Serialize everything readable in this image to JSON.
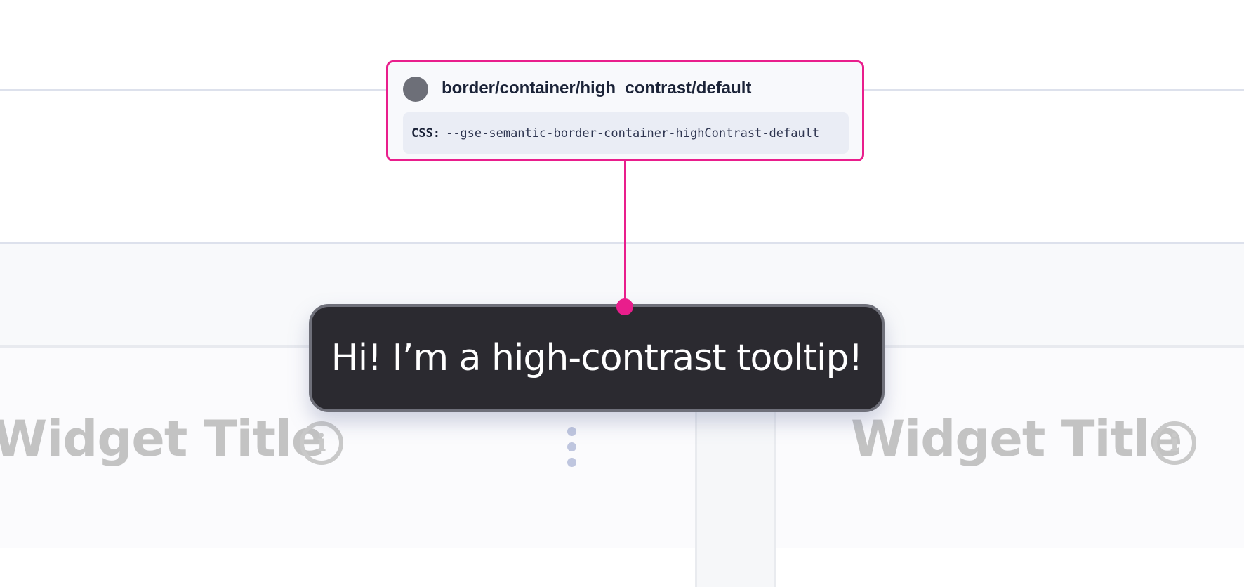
{
  "token": {
    "name": "border/container/high_contrast/default",
    "css_label": "CSS:",
    "css_variable": "--gse-semantic-border-container-highContrast-default",
    "swatch_color": "#6d6f78",
    "accent_color": "#e91e8c"
  },
  "tooltip": {
    "text": "Hi! I’m a high-contrast tooltip!"
  },
  "widgets": [
    {
      "title": "Widget Title",
      "icon": "info-icon"
    },
    {
      "title": "Widget Title",
      "icon": "info-icon"
    }
  ],
  "menu": {
    "icon": "kebab-menu-icon"
  }
}
